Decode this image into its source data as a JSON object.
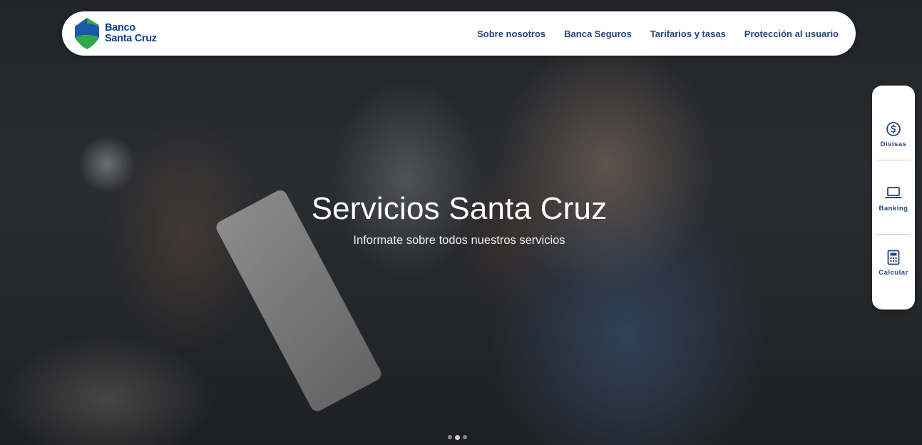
{
  "brand": {
    "line1": "Banco",
    "line2": "Santa Cruz",
    "colors": {
      "blue": "#1a5aa6",
      "green": "#2ea84a",
      "text": "#0d3f8a"
    }
  },
  "nav": {
    "items": [
      {
        "label": "Sobre nosotros"
      },
      {
        "label": "Banca Seguros"
      },
      {
        "label": "Tarifarios y tasas"
      },
      {
        "label": "Protección al usuario"
      }
    ],
    "color": "#24457e"
  },
  "hero": {
    "title": "Servicios Santa Cruz",
    "subtitle": "Informate sobre todos nuestros servicios"
  },
  "quick_access": {
    "items": [
      {
        "label": "Divisas",
        "icon": "dollar-circle-icon"
      },
      {
        "label": "Banking",
        "icon": "laptop-icon"
      },
      {
        "label": "Calcular",
        "icon": "calculator-icon"
      }
    ]
  },
  "carousel": {
    "slide_count": 3,
    "active_slide": 2
  }
}
